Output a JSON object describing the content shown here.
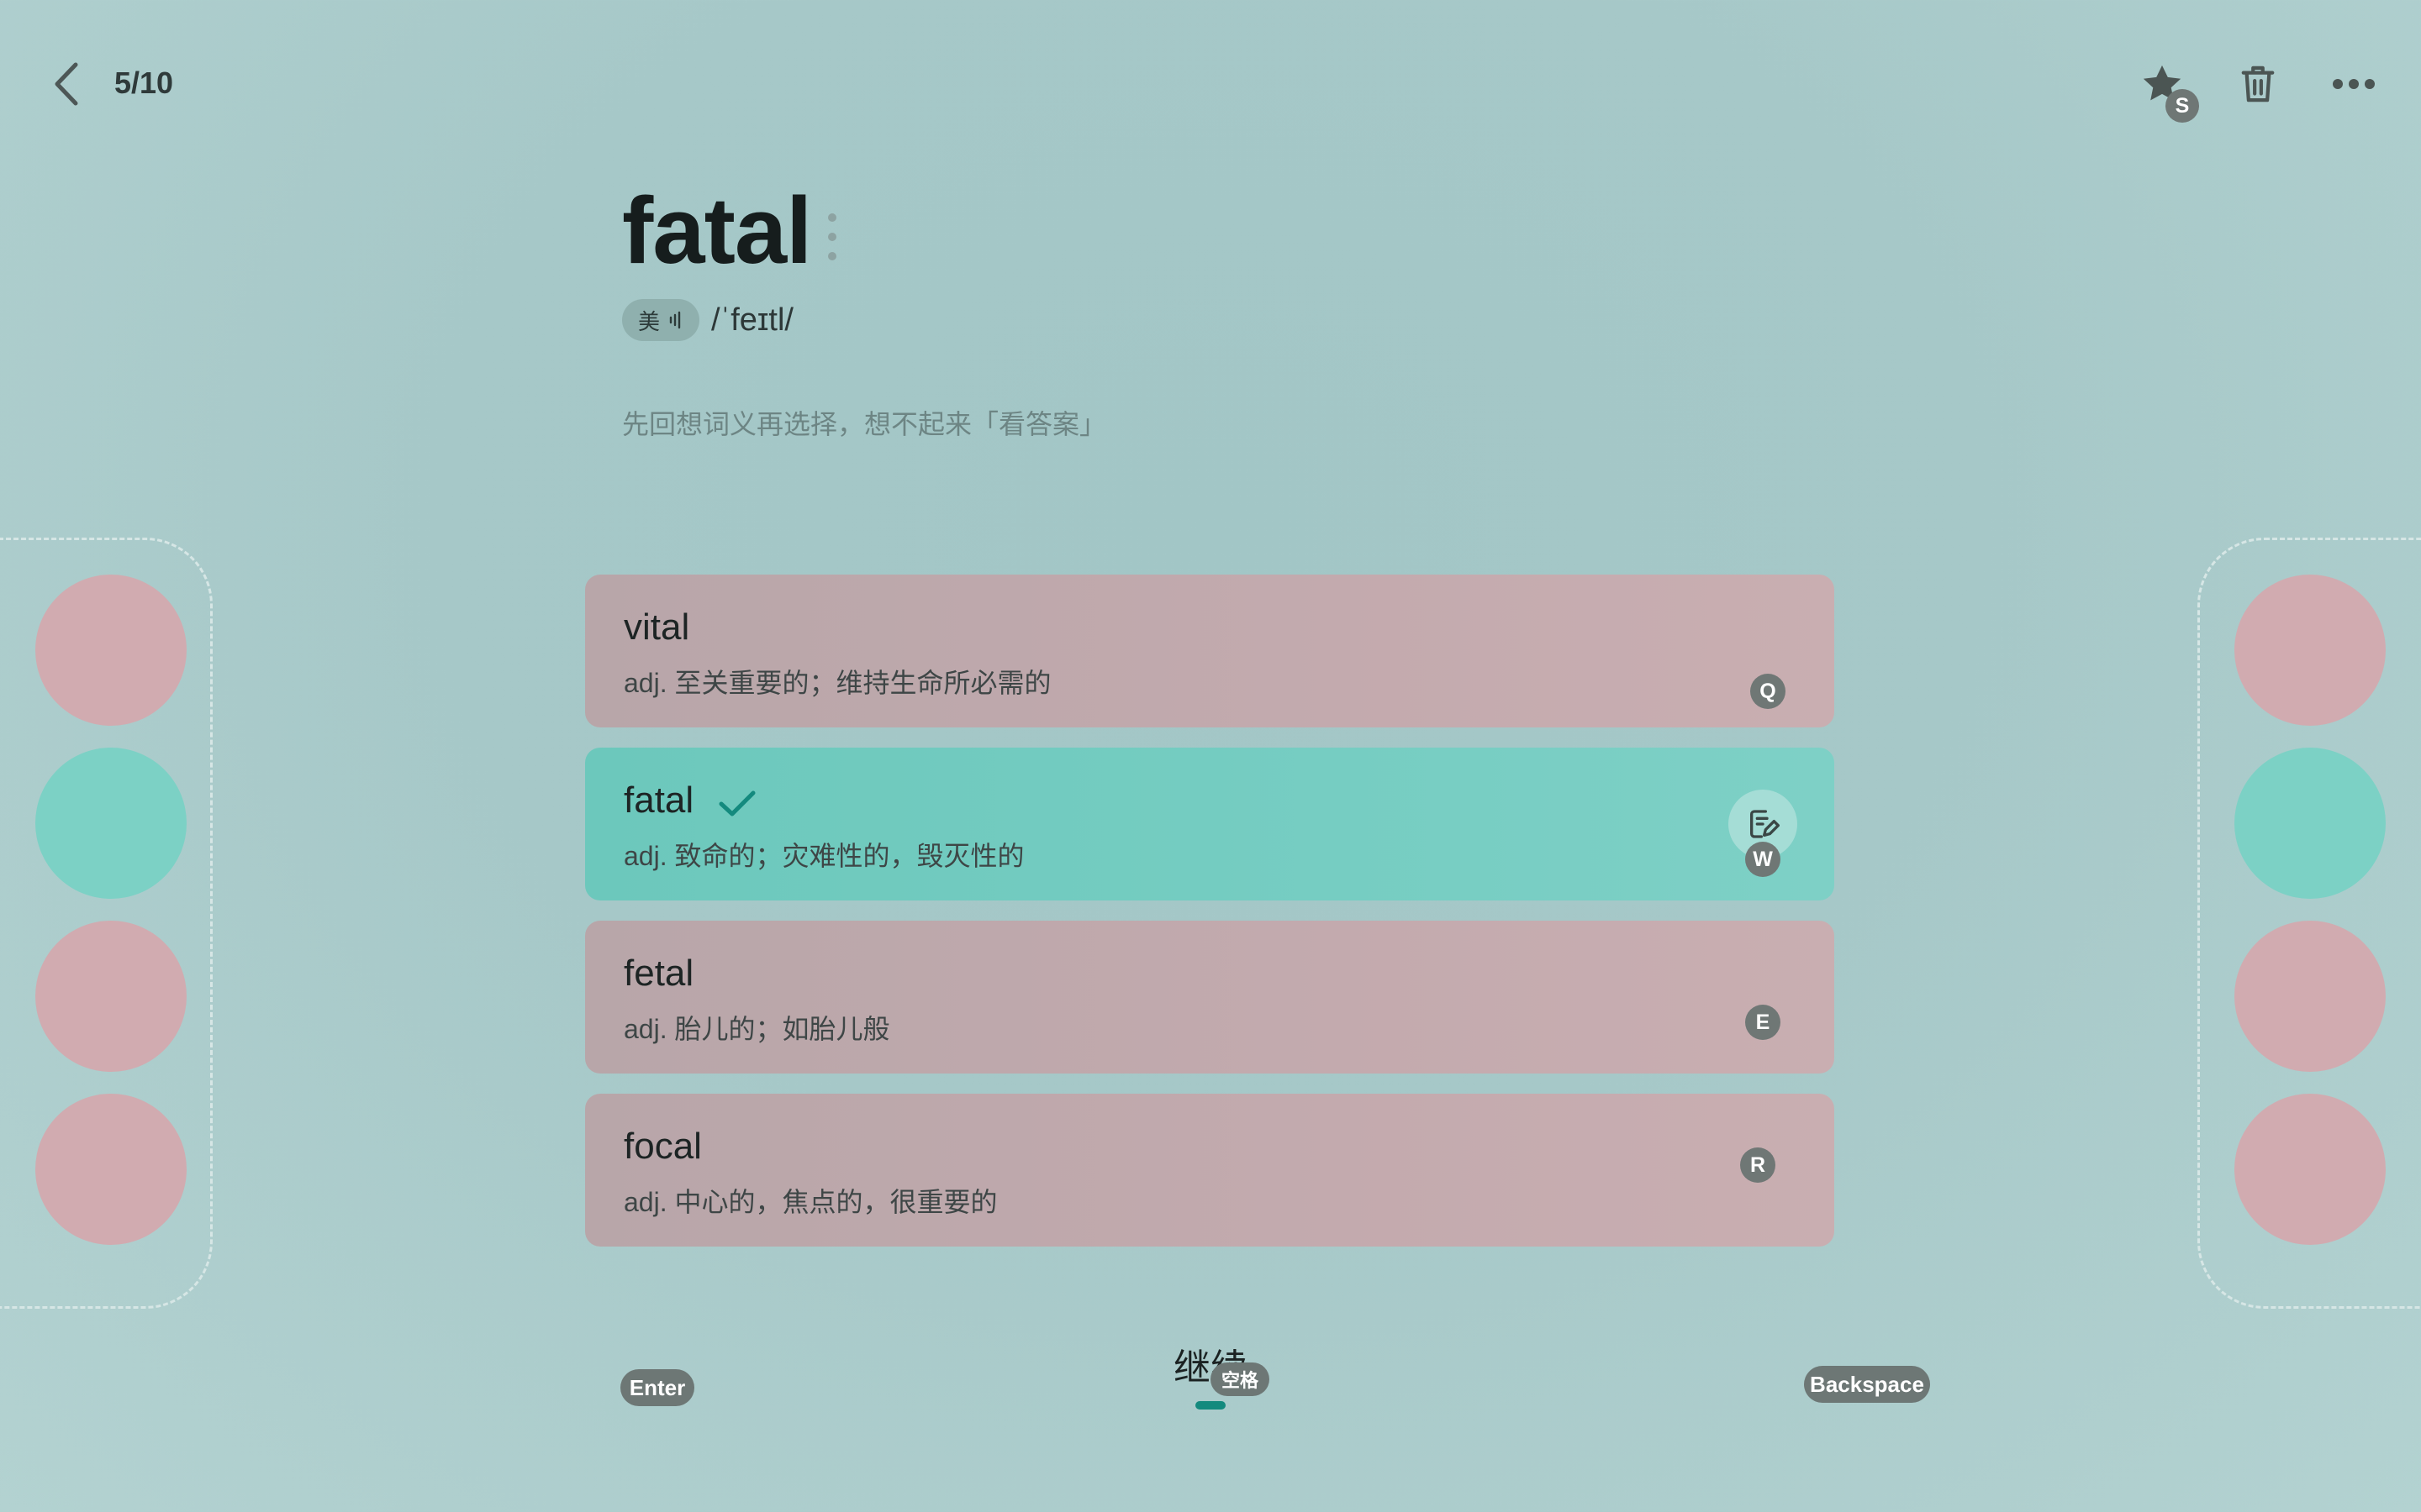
{
  "header": {
    "progress": "5/10",
    "star_shortcut": "S",
    "back_icon": "chevron-left-icon",
    "star_icon": "star-icon",
    "trash_icon": "trash-icon",
    "more_icon": "more-horizontal-icon"
  },
  "word": {
    "text": "fatal",
    "accent": "美",
    "phonetic": "/ˈfeɪtl/",
    "hint": "先回想词义再选择，想不起来「看答案」"
  },
  "options": [
    {
      "word": "vital",
      "meaning": "adj. 至关重要的；维持生命所必需的",
      "shortcut": "Q",
      "state": "wrong"
    },
    {
      "word": "fatal",
      "meaning": "adj. 致命的；灾难性的，毁灭性的",
      "shortcut": "W",
      "state": "correct"
    },
    {
      "word": "fetal",
      "meaning": "adj. 胎儿的；如胎儿般",
      "shortcut": "E",
      "state": "wrong"
    },
    {
      "word": "focal",
      "meaning": "adj. 中心的，焦点的，很重要的",
      "shortcut": "R",
      "state": "wrong"
    }
  ],
  "footer": {
    "enter_key": "Enter",
    "continue_label": "继续",
    "space_key": "空格",
    "backspace_key": "Backspace"
  },
  "colors": {
    "correct": "#76cdc2",
    "wrong": "#c3aaae",
    "accent": "#148a7e"
  }
}
